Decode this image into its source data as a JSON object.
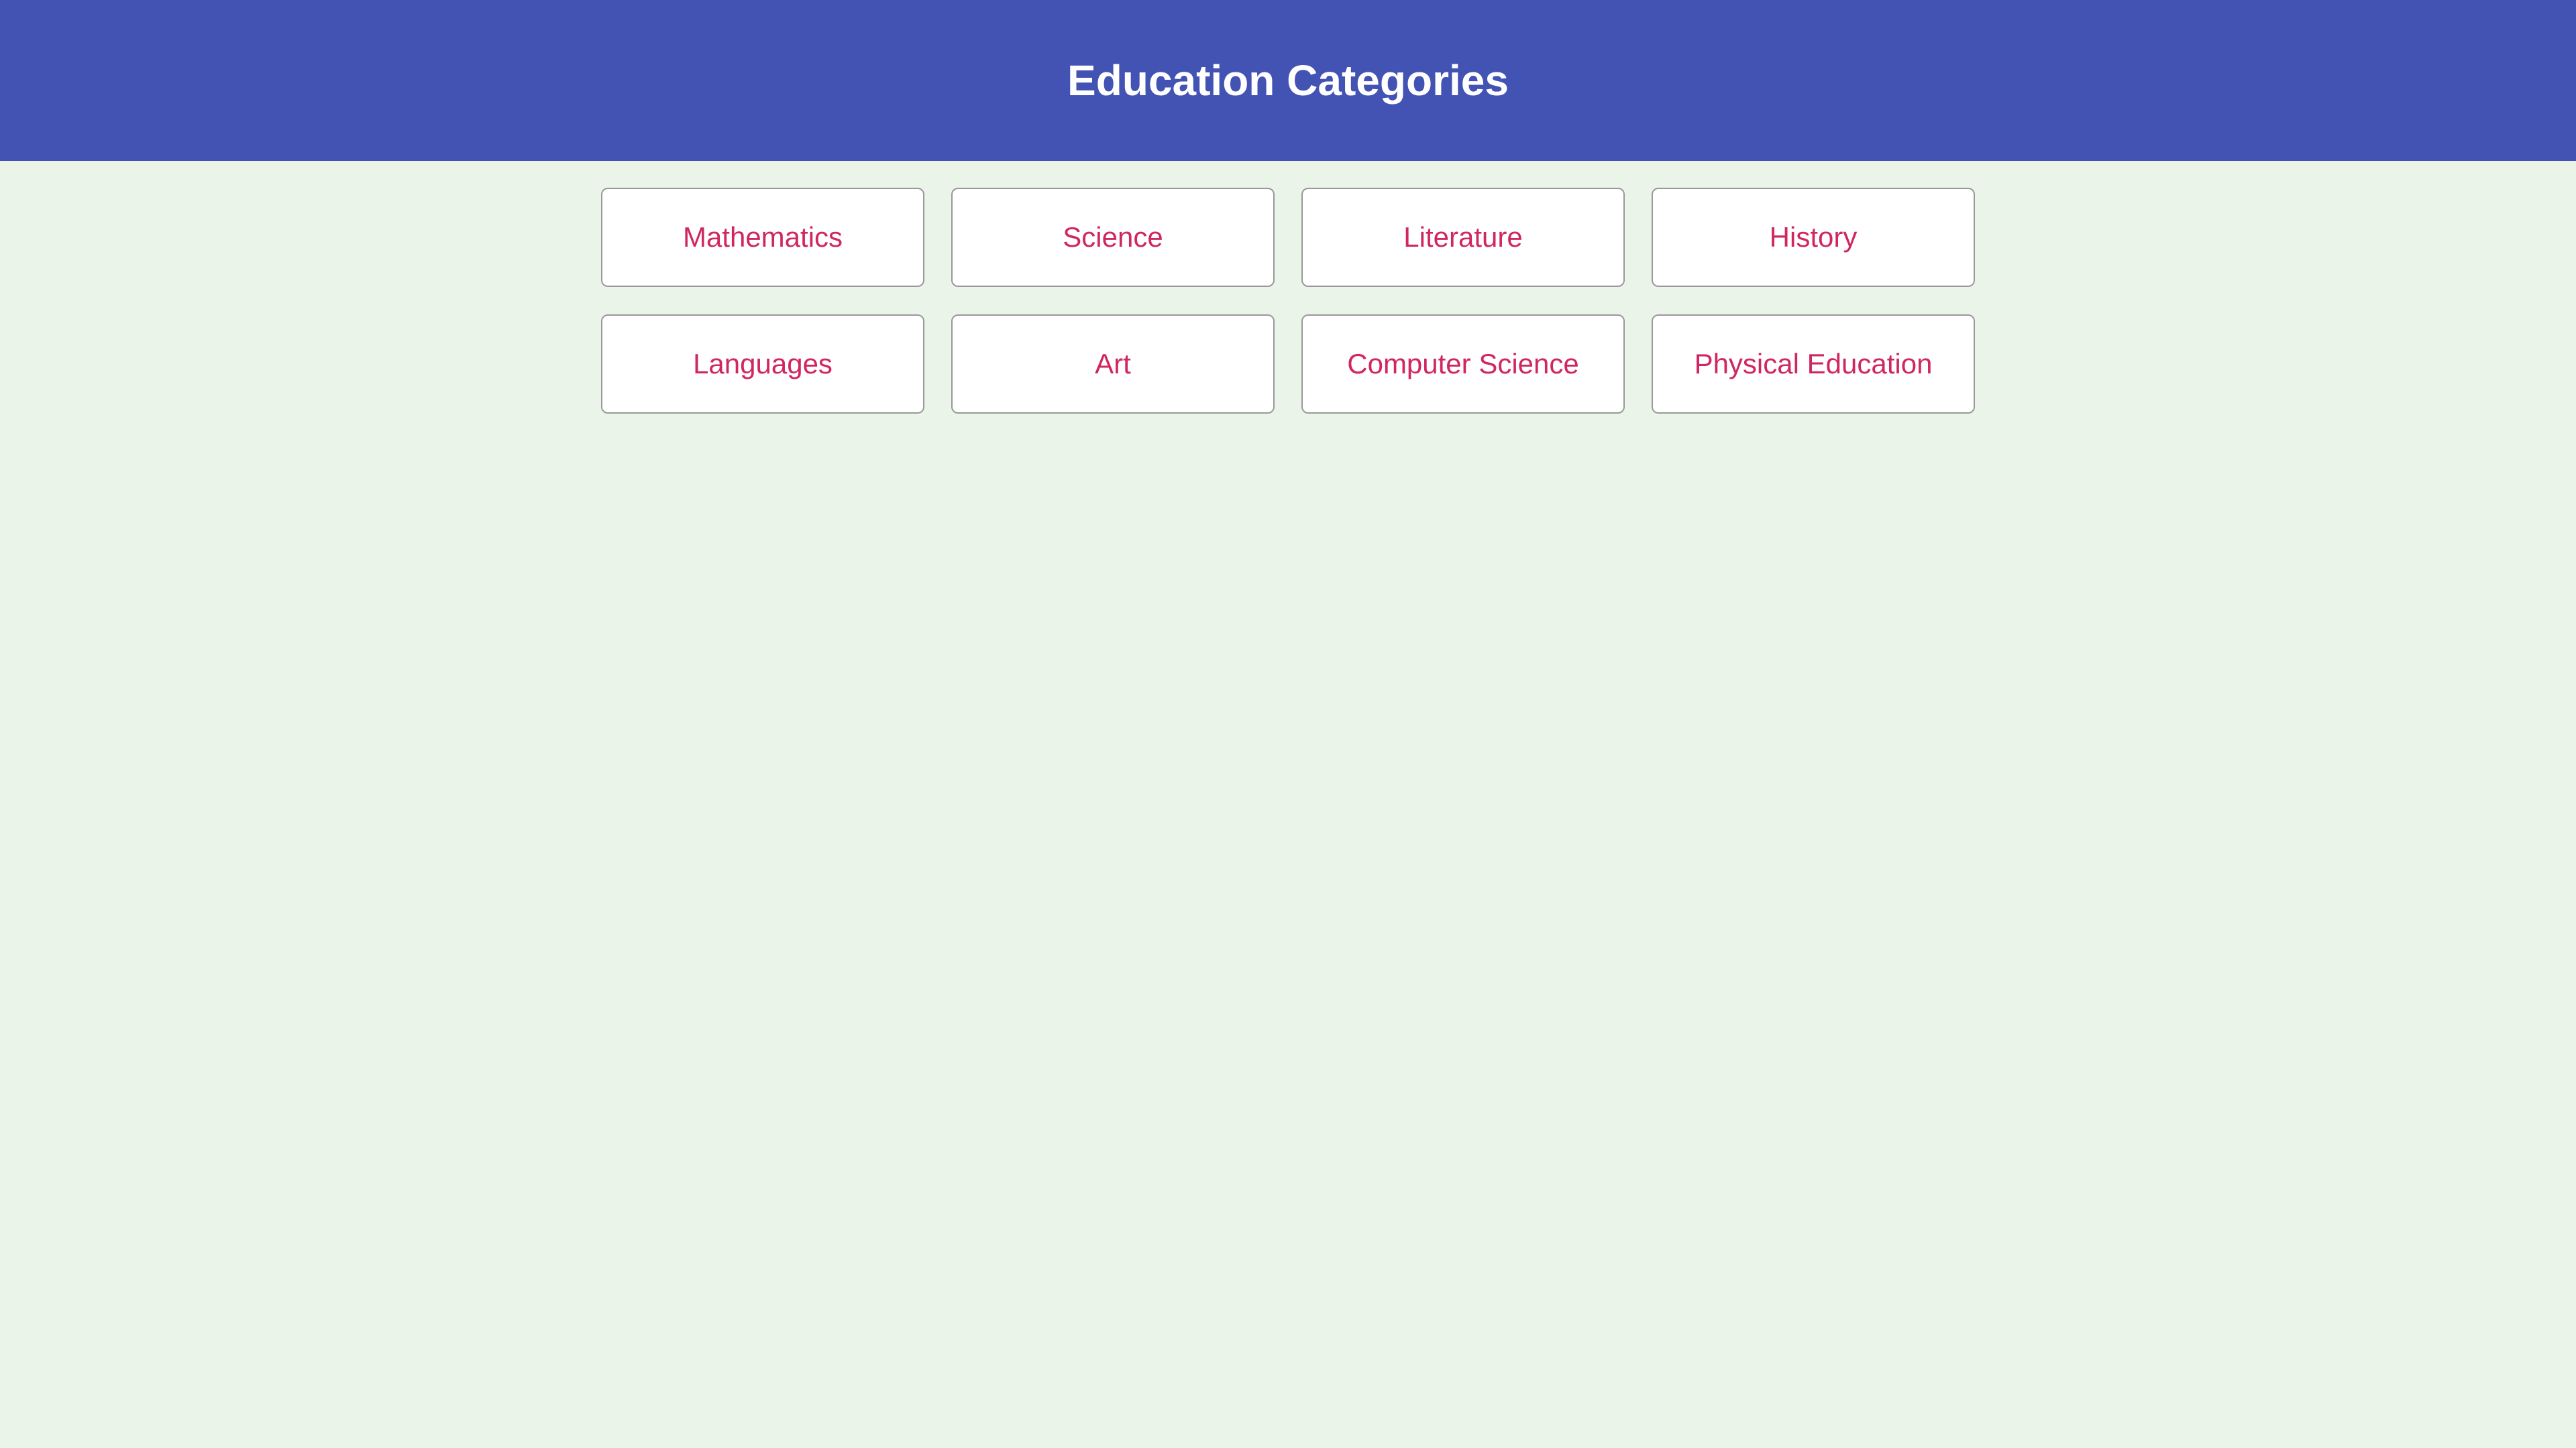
{
  "header": {
    "title": "Education Categories"
  },
  "categories": [
    {
      "label": "Mathematics"
    },
    {
      "label": "Science"
    },
    {
      "label": "Literature"
    },
    {
      "label": "History"
    },
    {
      "label": "Languages"
    },
    {
      "label": "Art"
    },
    {
      "label": "Computer Science"
    },
    {
      "label": "Physical Education"
    }
  ],
  "colors": {
    "header_bg": "#4353b3",
    "page_bg": "#eaf4e9",
    "card_text": "#d02661",
    "card_border": "#999999"
  }
}
